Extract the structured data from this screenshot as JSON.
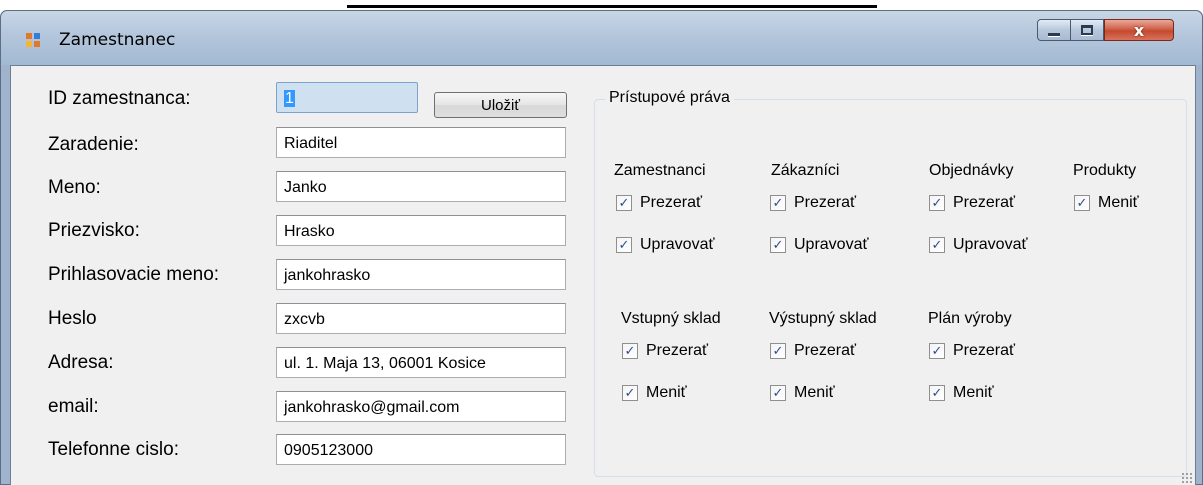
{
  "window": {
    "title": "Zamestnanec",
    "controls": {
      "minimize": "minimize-icon",
      "maximize": "maximize-icon",
      "close": "x"
    }
  },
  "form": {
    "fields": [
      {
        "label": "ID zamestnanca:",
        "value": "1"
      },
      {
        "label": "Zaradenie:",
        "value": "Riaditel"
      },
      {
        "label": "Meno:",
        "value": "Janko"
      },
      {
        "label": "Priezvisko:",
        "value": "Hrasko"
      },
      {
        "label": "Prihlasovacie meno:",
        "value": "jankohrasko"
      },
      {
        "label": "Heslo",
        "value": "zxcvb"
      },
      {
        "label": "Adresa:",
        "value": "ul. 1. Maja 13, 06001 Kosice"
      },
      {
        "label": "email:",
        "value": "jankohrasko@gmail.com"
      },
      {
        "label": "Telefonne cislo:",
        "value": "0905123000"
      }
    ],
    "save_label": "Uložiť"
  },
  "permissions": {
    "title": "Prístupové práva",
    "groups": [
      {
        "name": "Zamestnanci",
        "options": [
          {
            "label": "Prezerať",
            "checked": true
          },
          {
            "label": "Upravovať",
            "checked": true
          }
        ]
      },
      {
        "name": "Zákazníci",
        "options": [
          {
            "label": "Prezerať",
            "checked": true
          },
          {
            "label": "Upravovať",
            "checked": true
          }
        ]
      },
      {
        "name": "Objednávky",
        "options": [
          {
            "label": "Prezerať",
            "checked": true
          },
          {
            "label": "Upravovať",
            "checked": true
          }
        ]
      },
      {
        "name": "Produkty",
        "options": [
          {
            "label": "Meniť",
            "checked": true
          }
        ]
      },
      {
        "name": "Vstupný sklad",
        "options": [
          {
            "label": "Prezerať",
            "checked": true
          },
          {
            "label": "Meniť",
            "checked": true
          }
        ]
      },
      {
        "name": "Výstupný sklad",
        "options": [
          {
            "label": "Prezerať",
            "checked": true
          },
          {
            "label": "Meniť",
            "checked": true
          }
        ]
      },
      {
        "name": "Plán výroby",
        "options": [
          {
            "label": "Prezerať",
            "checked": true
          },
          {
            "label": "Meniť",
            "checked": true
          }
        ]
      }
    ],
    "check_mark": "✓"
  },
  "colors": {
    "titlebar": "#b3c6dc",
    "client": "#f0f0f0",
    "close_button": "#c34a30",
    "selection": "#3399ff"
  }
}
